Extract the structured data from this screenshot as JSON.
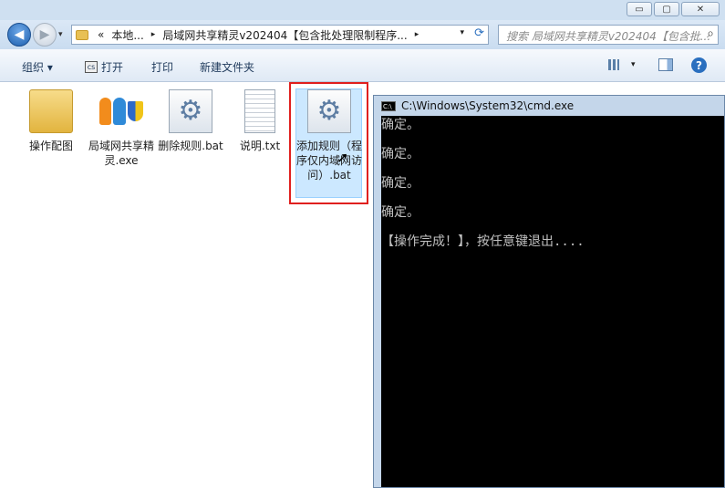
{
  "window": {
    "controls": {
      "minimize": "▭",
      "maximize": "▢",
      "close": "✕"
    }
  },
  "nav": {
    "address": {
      "overflow": "«",
      "crumbs": [
        "本地...",
        "局域网共享精灵v202404【包含批处理限制程序..."
      ],
      "separators": [
        "▸",
        "▸",
        "▸"
      ]
    },
    "search_placeholder": "搜索 局域网共享精灵v202404【包含批...",
    "icons": [
      "back-arrow-icon",
      "forward-arrow-icon",
      "refresh-icon",
      "search-icon"
    ]
  },
  "toolbar": {
    "organize": "组织 ▾",
    "open": "打开",
    "print": "打印",
    "new_folder": "新建文件夹"
  },
  "files": [
    {
      "name": "操作配图",
      "icon": "folder-icon"
    },
    {
      "name": "局域网共享精灵.exe",
      "icon": "app-icon"
    },
    {
      "name": "删除规则.bat",
      "icon": "batch-file-icon"
    },
    {
      "name": "说明.txt",
      "icon": "text-file-icon"
    },
    {
      "name": "添加规则（程序仅内域网访问）.bat",
      "icon": "batch-file-icon",
      "selected": true
    }
  ],
  "cmd": {
    "title": "C:\\Windows\\System32\\cmd.exe",
    "lines": [
      "确定。",
      "确定。",
      "确定。",
      "确定。",
      "【操作完成！】，按任意键退出...."
    ]
  },
  "colors": {
    "highlight": "#e0201e",
    "selection": "#cce8ff",
    "console_bg": "#000000",
    "console_fg": "#c0c0c0"
  }
}
